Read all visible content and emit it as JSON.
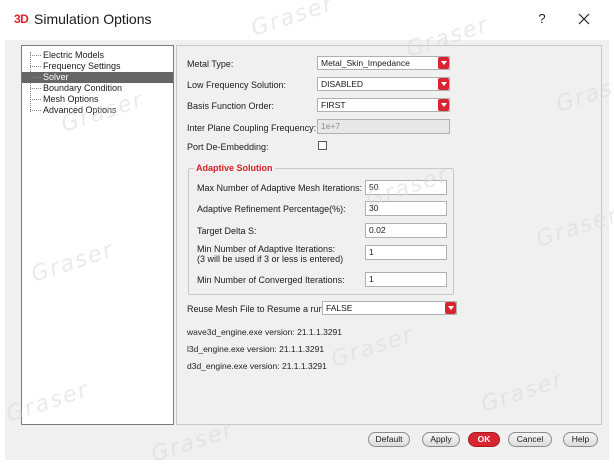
{
  "window": {
    "logo": "3D",
    "title": "Simulation Options",
    "help": "?",
    "close": "✕"
  },
  "tree": {
    "items": [
      {
        "label": "Electric Models",
        "selected": false
      },
      {
        "label": "Frequency Settings",
        "selected": false
      },
      {
        "label": "Solver",
        "selected": true
      },
      {
        "label": "Boundary Condition",
        "selected": false
      },
      {
        "label": "Mesh Options",
        "selected": false
      },
      {
        "label": "Advanced Options",
        "selected": false
      }
    ]
  },
  "solver": {
    "metal_type": {
      "label": "Metal Type:",
      "value": "Metal_Skin_Impedance"
    },
    "low_freq": {
      "label": "Low Frequency Solution:",
      "value": "DISABLED"
    },
    "basis_order": {
      "label": "Basis Function Order:",
      "value": "FIRST"
    },
    "inter_plane": {
      "label": "Inter Plane Coupling Frequency:",
      "value": "1e+7"
    },
    "port_deembed": {
      "label": "Port De-Embedding:",
      "checked": false
    },
    "adaptive": {
      "title": "Adaptive Solution",
      "max_iter": {
        "label": "Max Number of Adaptive Mesh Iterations:",
        "value": "50"
      },
      "refine_pct": {
        "label": "Adaptive Refinement Percentage(%):",
        "value": "30"
      },
      "delta_s": {
        "label": "Target Delta S:",
        "value": "0.02"
      },
      "min_iter": {
        "label_line1": "Min Number of Adaptive Iterations:",
        "label_line2": "(3 will be used if 3 or less is entered)",
        "value": "1"
      },
      "min_conv": {
        "label": "Min Number of Converged Iterations:",
        "value": "1"
      }
    },
    "reuse_mesh": {
      "label": "Reuse Mesh File to Resume a run:",
      "value": "FALSE"
    },
    "versions": [
      "wave3d_engine.exe version: 21.1.1.3291",
      "l3d_engine.exe version: 21.1.1.3291",
      "d3d_engine.exe version: 21.1.1.3291"
    ]
  },
  "buttons": {
    "default": "Default",
    "apply": "Apply",
    "ok": "OK",
    "cancel": "Cancel",
    "help": "Help"
  },
  "watermark": "Graser",
  "colors": {
    "accent": "#d8252f",
    "selection": "#666666"
  }
}
